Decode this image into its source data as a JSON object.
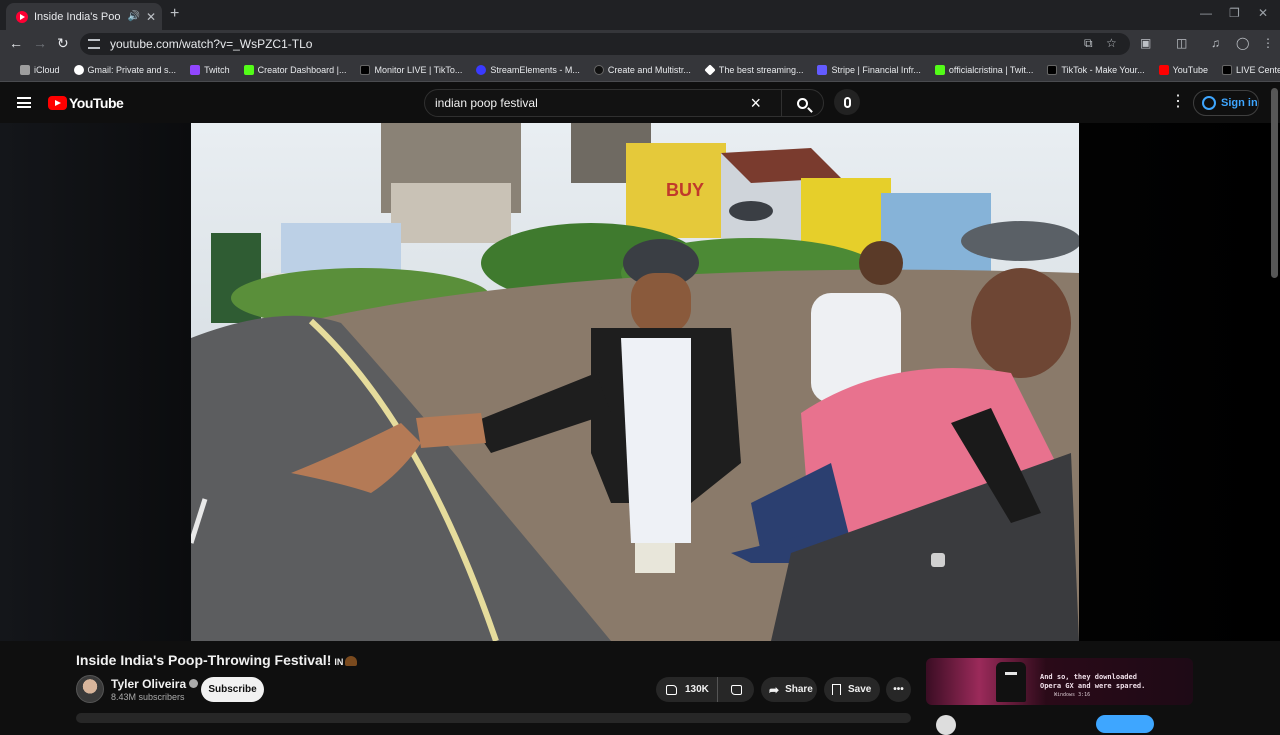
{
  "browser": {
    "tab_title": "Inside India's Poop-Throwi",
    "url": "youtube.com/watch?v=_WsPZC1-TLo",
    "bookmarks": [
      {
        "label": "iCloud",
        "color": "#9e9e9e"
      },
      {
        "label": "Gmail: Private and s...",
        "color": "#ffffff"
      },
      {
        "label": "Twitch",
        "color": "#9146ff"
      },
      {
        "label": "Creator Dashboard |...",
        "color": "#53fc18"
      },
      {
        "label": "Monitor LIVE | TikTo...",
        "color": "#000000"
      },
      {
        "label": "StreamElements - M...",
        "color": "#3a3aff"
      },
      {
        "label": "Create and Multistr...",
        "color": "#111111"
      },
      {
        "label": "The best streaming...",
        "color": "#ffffff"
      },
      {
        "label": "Stripe | Financial Infr...",
        "color": "#635bff"
      },
      {
        "label": "officialcristina | Twit...",
        "color": "#53fc18"
      },
      {
        "label": "TikTok - Make Your...",
        "color": "#000000"
      },
      {
        "label": "YouTube",
        "color": "#ff0000"
      },
      {
        "label": "LIVE Center",
        "color": "#000000"
      }
    ]
  },
  "header": {
    "logo_text": "YouTube",
    "search_query": "indian poop festival",
    "sign_in": "Sign in"
  },
  "video": {
    "title": "Inside India's Poop-Throwing Festival!",
    "flag": "IN",
    "channel": "Tyler Oliveira",
    "subscribers": "8.43M subscribers",
    "subscribe_label": "Subscribe",
    "likes": "130K",
    "share_label": "Share",
    "save_label": "Save",
    "sign_text": "BUY"
  },
  "ad": {
    "line1": "And so, they downloaded",
    "line2": "Opera GX and were spared.",
    "small": "Windows 3:16"
  },
  "colors": {
    "accent_blue": "#3ea6ff",
    "yt_red": "#ff0000",
    "bg": "#0f0f0f"
  }
}
